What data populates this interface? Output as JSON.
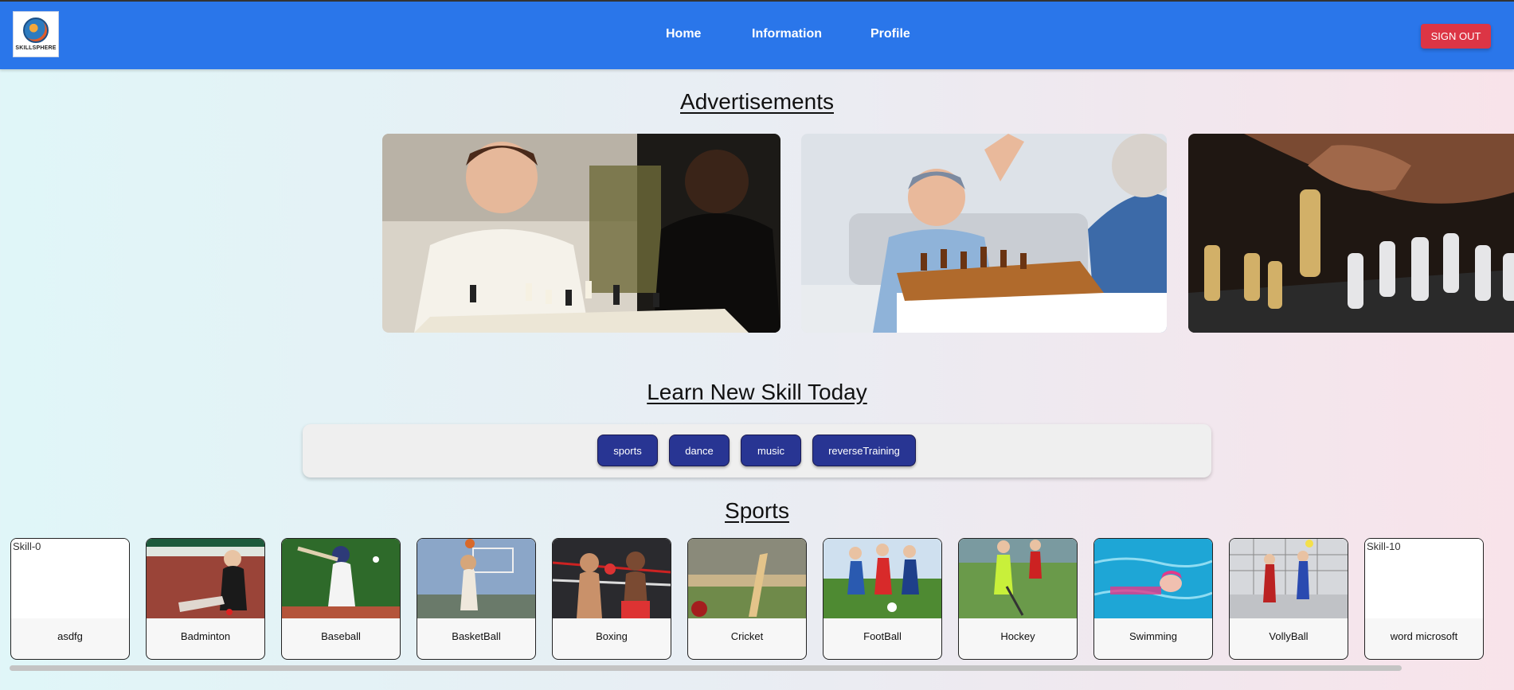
{
  "header": {
    "logo_text": "SKILLSPHERE",
    "nav": [
      "Home",
      "Information",
      "Profile"
    ],
    "signout_label": "SIGN OUT"
  },
  "ads": {
    "title": "Advertisements",
    "images": [
      "chess-kids-playing-photo",
      "boy-grandfather-high-five-chess-photo",
      "chess-pieces-hand-moving-photo"
    ]
  },
  "skills": {
    "title": "Learn New Skill Today",
    "categories": [
      "sports",
      "dance",
      "music",
      "reverseTraining"
    ]
  },
  "sports": {
    "title": "Sports",
    "cards": [
      {
        "label": "asdfg",
        "alt": "Skill-0",
        "broken": true
      },
      {
        "label": "Badminton",
        "alt": "",
        "broken": false
      },
      {
        "label": "Baseball",
        "alt": "",
        "broken": false
      },
      {
        "label": "BasketBall",
        "alt": "",
        "broken": false
      },
      {
        "label": "Boxing",
        "alt": "",
        "broken": false
      },
      {
        "label": "Cricket",
        "alt": "",
        "broken": false
      },
      {
        "label": "FootBall",
        "alt": "",
        "broken": false
      },
      {
        "label": "Hockey",
        "alt": "",
        "broken": false
      },
      {
        "label": "Swimming",
        "alt": "",
        "broken": false
      },
      {
        "label": "VollyBall",
        "alt": "",
        "broken": false
      },
      {
        "label": "word microsoft",
        "alt": "Skill-10",
        "broken": true
      }
    ]
  },
  "colors": {
    "navbar": "#2a76ea",
    "signout": "#dc3545",
    "skill_button": "#283593"
  }
}
